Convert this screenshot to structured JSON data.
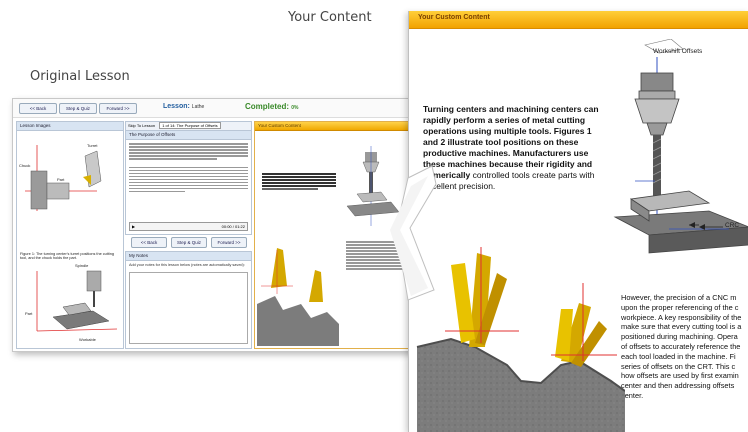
{
  "captions": {
    "your_content": "Your Content",
    "original_lesson": "Original Lesson"
  },
  "lesson_ui": {
    "nav": {
      "back": "<< Back",
      "step_quiz": "Step & Quiz",
      "forward": "Forward >>"
    },
    "lesson_label": "Lesson:",
    "lesson_value": "Lathe",
    "completed_label": "Completed:",
    "completed_value": "0%",
    "lesson_images_title": "Lesson Images",
    "skip_to_lesson": "Skip To Lesson",
    "lesson_select": "1 of 14: The Purpose of Offsets",
    "section_title": "The Purpose of Offsets",
    "figure_caption": "Figure 1: The turning center's turret positions the cutting tool, and the chuck holds the part.",
    "fig_labels": [
      "Chuck",
      "Part",
      "Turret",
      "Spindle",
      "Workable",
      "Part"
    ],
    "audio_time": "00:00 / 01:22",
    "my_notes_title": "My Notes",
    "notes_hint": "Add your notes for this lesson below (notes are automatically saved):",
    "bottom_nav": {
      "back": "<< Back",
      "step_quiz": "Step & Quiz",
      "forward": "Forward >>"
    },
    "custom_content_title": "Your Custom Content"
  },
  "custom_content": {
    "header": "Your Custom Content",
    "para1_bold": "Turning centers and machining centers can rapidly perform a series of metal cutting operations using multiple tools. Figures 1 and 2 illustrate tool positions on these productive machines. Manufacturers use these machines because their rigidity and numerically",
    "para1_normal": "controlled tools create parts with excellent precision.",
    "para2_lines": [
      "However, the precision of a CNC m",
      "upon the proper referencing of the c",
      "workpiece. A key responsibility of the",
      "make sure that every cutting tool is a",
      "positioned during machining. Opera",
      "of offsets to accurately reference the",
      "each tool loaded in the machine. Fi",
      "series of offsets on the CRT. This c",
      "how offsets are used by first examin",
      "center and then addressing offsets",
      "center."
    ],
    "figure_labels": {
      "workshift": "Workshift Offsets",
      "crc": "CRC"
    }
  },
  "colors": {
    "header_gold": "#f2a200",
    "panel_blue": "#d8e4f2",
    "link_blue": "#2560a0",
    "completed_green": "#3a8a2a"
  }
}
